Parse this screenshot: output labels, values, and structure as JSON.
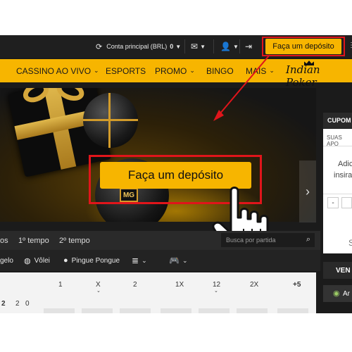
{
  "topbar": {
    "account_label": "Conta principal (BRL)",
    "balance": "0",
    "deposit_button": "Faça um depósito"
  },
  "nav": {
    "items": [
      "CASSINO AO VIVO",
      "ESPORTS",
      "PROMO",
      "BINGO",
      "MAIS"
    ],
    "logo": "Indian Poker"
  },
  "banner": {
    "cta": "Faça um depósito",
    "ball_logo": "MG"
  },
  "tabs": {
    "items": [
      "os",
      "1º tempo",
      "2º tempo"
    ],
    "search_placeholder": "Busca por partida"
  },
  "sports": {
    "items": [
      "gelo",
      "Vôlei",
      "Pingue Pongue"
    ]
  },
  "table": {
    "headers": [
      "1",
      "X",
      "2",
      "1X",
      "12",
      "2X",
      "+5"
    ],
    "first_row": [
      "2",
      "2",
      "0"
    ]
  },
  "sidebar": {
    "cupom_title": "CUPOM",
    "suas_apostas": "SUAS APO",
    "add_line1": "Adic",
    "add_line2": "insira",
    "minus": "-",
    "s_label": "S",
    "vend_label": "VEN",
    "ar_label": "Ar"
  },
  "colors": {
    "accent": "#f7b500",
    "highlight_red": "#e0151b",
    "dark_bg": "#1b1b1b"
  },
  "icons": [
    "refresh-icon",
    "mail-icon",
    "user-icon",
    "logout-icon",
    "chevron-down-icon",
    "search-icon",
    "chevron-right-icon",
    "hand-cursor-icon",
    "volleyball-icon",
    "table-tennis-icon",
    "gamepad-icon",
    "list-icon",
    "android-icon"
  ]
}
